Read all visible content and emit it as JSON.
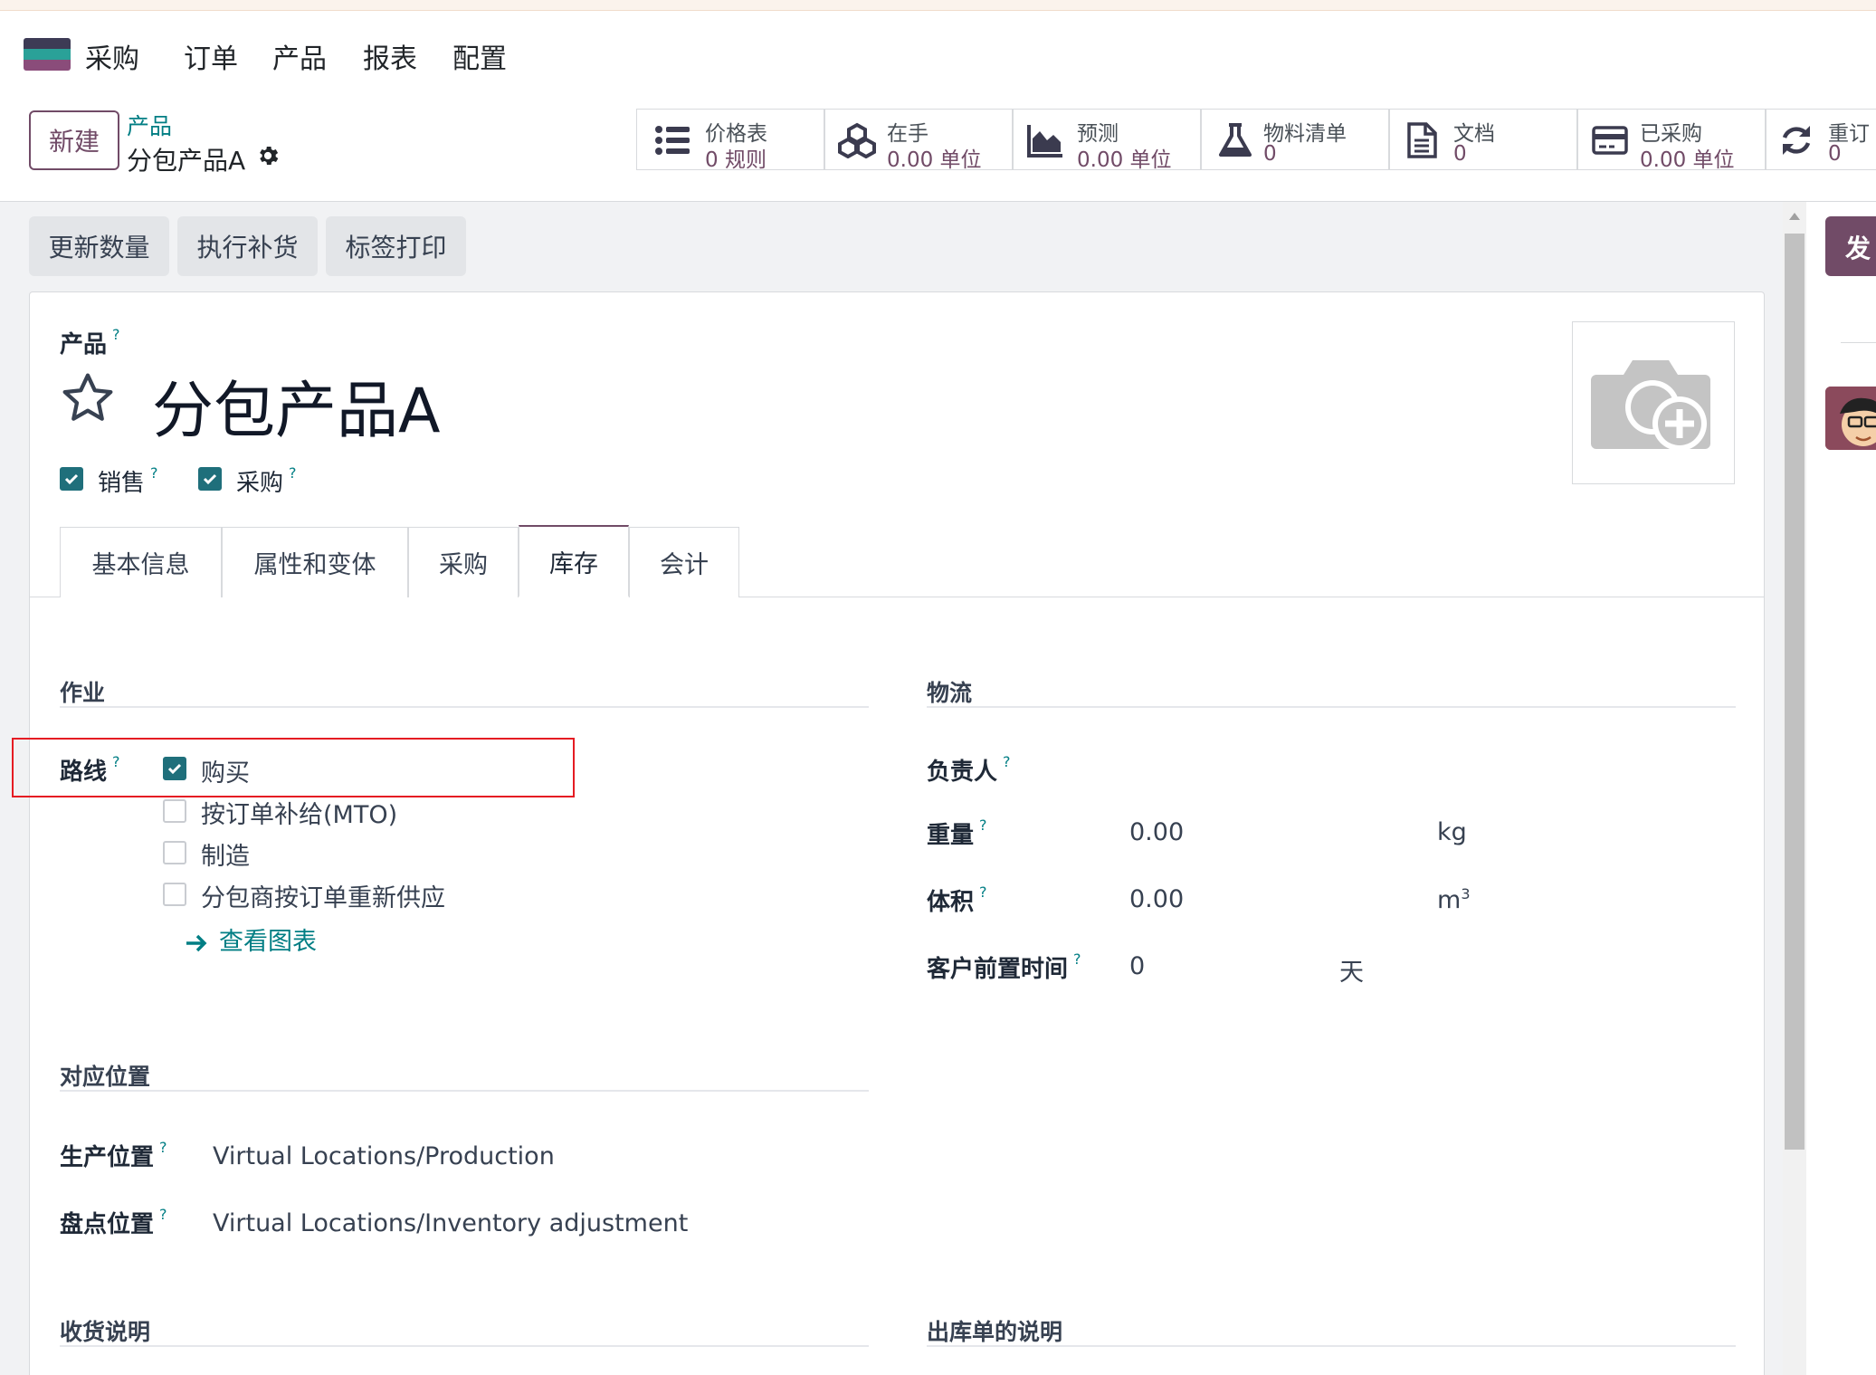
{
  "nav": {
    "app_name": "采购",
    "menus": [
      "订单",
      "产品",
      "报表",
      "配置"
    ]
  },
  "control_panel": {
    "new_button": "新建",
    "breadcrumb_parent": "产品",
    "breadcrumb_current": "分包产品A",
    "smart_buttons": [
      {
        "icon": "list-icon",
        "line1": "价格表",
        "line2": "0 规则"
      },
      {
        "icon": "cubes-icon",
        "line1": "在手",
        "line2": "0.00 单位"
      },
      {
        "icon": "area-chart-icon",
        "line1": "预测",
        "line2": "0.00 单位"
      },
      {
        "icon": "flask-icon",
        "line1": "物料清单",
        "line2": "0"
      },
      {
        "icon": "document-icon",
        "line1": "文档",
        "line2": "0"
      },
      {
        "icon": "credit-card-icon",
        "line1": "已采购",
        "line2": "0.00 单位"
      },
      {
        "icon": "refresh-icon",
        "line1": "重订",
        "line2": "0"
      }
    ]
  },
  "actions": [
    "更新数量",
    "执行补货",
    "标签打印"
  ],
  "chatter": {
    "send_button": "发"
  },
  "form": {
    "name_label": "产品",
    "name": "分包产品A",
    "sale_ok_label": "销售",
    "purchase_ok_label": "采购",
    "tabs": [
      "基本信息",
      "属性和变体",
      "采购",
      "库存",
      "会计"
    ],
    "active_tab": "库存",
    "operations": {
      "title": "作业",
      "routes_label": "路线",
      "routes": [
        {
          "label": "购买",
          "checked": true
        },
        {
          "label": "按订单补给(MTO)",
          "checked": false
        },
        {
          "label": "制造",
          "checked": false
        },
        {
          "label": "分包商按订单重新供应",
          "checked": false
        }
      ],
      "view_diagram": "查看图表"
    },
    "logistics": {
      "title": "物流",
      "responsible_label": "负责人",
      "weight_label": "重量",
      "weight_value": "0.00",
      "weight_unit": "kg",
      "volume_label": "体积",
      "volume_value": "0.00",
      "volume_unit": "m",
      "volume_unit_sup": "3",
      "lead_time_label": "客户前置时间",
      "lead_time_value": "0",
      "lead_time_unit": "天"
    },
    "locations": {
      "title": "对应位置",
      "production_label": "生产位置",
      "production_value": "Virtual Locations/Production",
      "inventory_label": "盘点位置",
      "inventory_value": "Virtual Locations/Inventory adjustment"
    },
    "receipt_desc_title": "收货说明",
    "delivery_desc_title": "出库单的说明"
  },
  "colors": {
    "brand": "#714b67",
    "teal": "#017e84",
    "highlight": "#e51c23"
  }
}
